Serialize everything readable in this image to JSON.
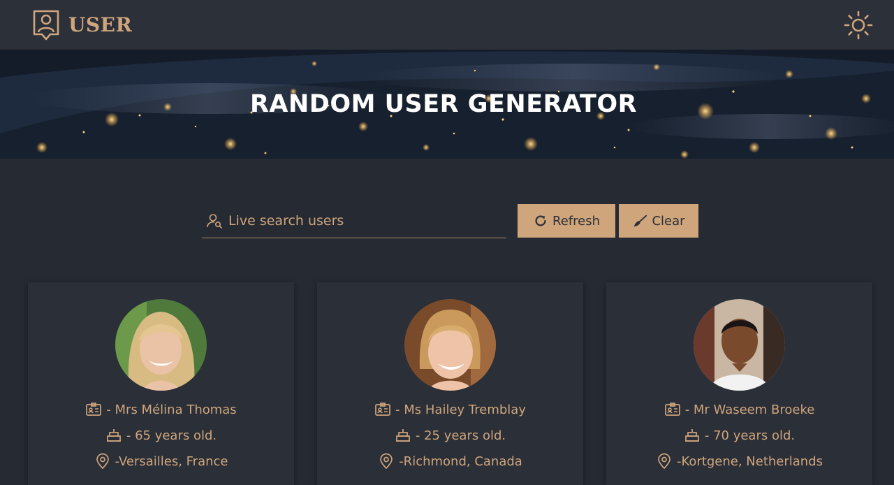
{
  "navbar": {
    "brand": "USER",
    "brand_icon": "user-badge-icon",
    "theme_icon": "sun-icon"
  },
  "hero": {
    "title": "RANDOM USER GENERATOR"
  },
  "search": {
    "placeholder": "Live search users",
    "icon": "user-search-icon"
  },
  "buttons": {
    "refresh_label": "Refresh",
    "clear_label": "Clear"
  },
  "users": [
    {
      "name": " - Mrs Mélina Thomas",
      "age": " - 65 years old.",
      "location": " -Versailles, France"
    },
    {
      "name": " - Ms Hailey Tremblay",
      "age": " - 25 years old.",
      "location": " -Richmond, Canada"
    },
    {
      "name": " - Mr Waseem Broeke",
      "age": " - 70 years old.",
      "location": " -Kortgene, Netherlands"
    }
  ],
  "colors": {
    "accent": "#cfa57c",
    "background": "#252a33",
    "navbar": "#2c3039",
    "card": "#2a2f38"
  }
}
